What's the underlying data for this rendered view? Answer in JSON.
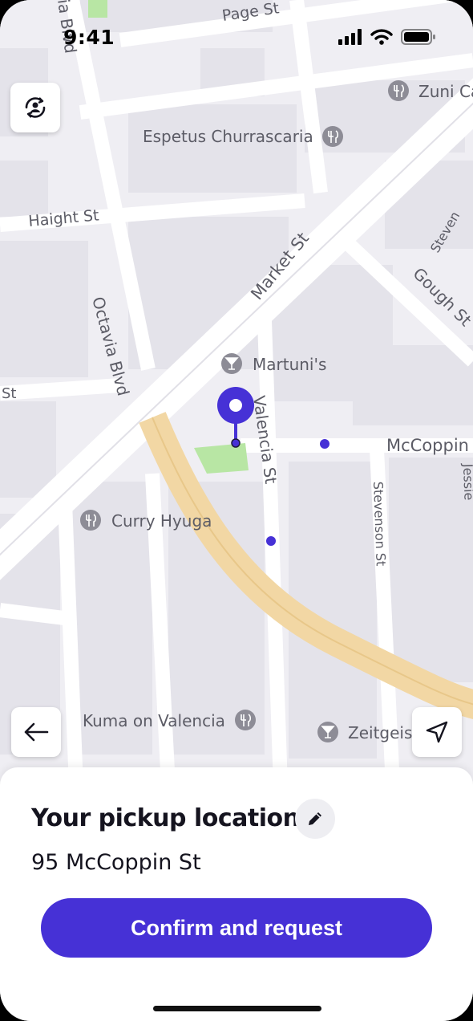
{
  "status_bar": {
    "time": "9:41"
  },
  "map": {
    "streets": {
      "page": "Page St",
      "haight": "Haight St",
      "market": "Market St",
      "octavia": "Octavia Blvd",
      "valencia": "Valencia St",
      "mccoppin": "McCoppin",
      "gough": "Gough St",
      "stevenson_east": "Stevenson St",
      "stevenson_top": "Steven",
      "octavia_top": "ia Blvd",
      "jessie": "Jessie",
      "st_left": "St"
    },
    "places": {
      "zuni": "Zuni Ca",
      "espetus": "Espetus Churrascaria",
      "martunis": "Martuni's",
      "curry_hyuga": "Curry Hyuga",
      "kuma": "Kuma on Valencia",
      "zeitgeist": "Zeitgeist"
    },
    "accent_color": "#4631d6"
  },
  "pickup": {
    "title": "Your pickup location",
    "address": "95 McCoppin St",
    "confirm_label": "Confirm and request"
  }
}
